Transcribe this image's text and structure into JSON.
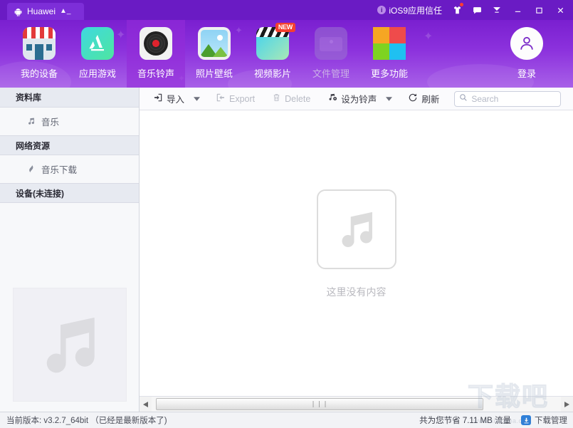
{
  "titlebar": {
    "tab": {
      "label": "Huawei",
      "icon": "android-icon",
      "eject_icon": "eject-icon"
    },
    "ios_note": {
      "label": "iOS9应用信任",
      "icon": "info-icon"
    },
    "icons": [
      {
        "name": "skin-icon",
        "glyph": "T",
        "has_dot": true
      },
      {
        "name": "feedback-chat-icon",
        "glyph": "▢"
      },
      {
        "name": "minimize-to-tray-icon",
        "glyph": "☰"
      }
    ],
    "window_buttons": [
      {
        "name": "minimize-button",
        "glyph": "—"
      },
      {
        "name": "maximize-button",
        "glyph": "□"
      },
      {
        "name": "close-button",
        "glyph": "✕"
      }
    ]
  },
  "nav": {
    "items": [
      {
        "label": "我的设备",
        "icon": "my-device-icon",
        "active": false,
        "disabled": false
      },
      {
        "label": "应用游戏",
        "icon": "apps-games-icon",
        "active": false,
        "disabled": false
      },
      {
        "label": "音乐铃声",
        "icon": "music-ringtones-icon",
        "active": true,
        "disabled": false
      },
      {
        "label": "照片壁纸",
        "icon": "photos-wallpaper-icon",
        "active": false,
        "disabled": false
      },
      {
        "label": "视频影片",
        "icon": "video-movies-icon",
        "active": false,
        "disabled": false,
        "badge": "NEW"
      },
      {
        "label": "文件管理",
        "icon": "file-manager-icon",
        "active": false,
        "disabled": true
      },
      {
        "label": "更多功能",
        "icon": "more-features-icon",
        "active": false,
        "disabled": false
      }
    ],
    "login": {
      "label": "登录",
      "icon": "user-avatar-icon"
    },
    "more_colors": [
      "#f6a623",
      "#ef4b4b",
      "#7ed321",
      "#1fc0f1"
    ]
  },
  "sidebar": {
    "sections": [
      {
        "header": "资料库",
        "items": [
          {
            "label": "音乐",
            "icon": "music-note-icon"
          }
        ]
      },
      {
        "header": "网络资源",
        "items": [
          {
            "label": "音乐下载",
            "icon": "music-download-icon"
          }
        ]
      },
      {
        "header": "设备(未连接)",
        "items": []
      }
    ],
    "placeholder_icon": "music-note-placeholder-icon"
  },
  "toolbar": {
    "import_label": "导入",
    "import_icon": "import-icon",
    "export_label": "Export",
    "export_icon": "export-icon",
    "delete_label": "Delete",
    "delete_icon": "trash-icon",
    "ringtone_label": "设为铃声",
    "ringtone_icon": "ringtone-icon",
    "refresh_label": "刷新",
    "refresh_icon": "refresh-icon",
    "caret_icon": "chevron-down-icon",
    "search": {
      "placeholder": "Search",
      "value": "",
      "icon": "search-icon"
    }
  },
  "content": {
    "empty_text": "这里没有内容",
    "empty_icon": "music-note-empty-icon"
  },
  "scrollbar": {
    "left_arrow": "◀",
    "right_arrow": "▶",
    "grip": "❘❘❘"
  },
  "statusbar": {
    "version_text": "当前版本: v3.2.7_64bit （已经是最新版本了)",
    "saved_text": "共为您节省 7.11 MB 流量",
    "download_manager_label": "下载管理",
    "download_icon": "download-icon"
  },
  "watermark": {
    "big": "下载吧",
    "url": "www.xiazaiba.com"
  },
  "colors": {
    "brand_purple": "#8c32dd",
    "titlebar_purple": "#6a1bc4",
    "accent_red": "#f4402f",
    "download_blue": "#2f7fd8"
  }
}
